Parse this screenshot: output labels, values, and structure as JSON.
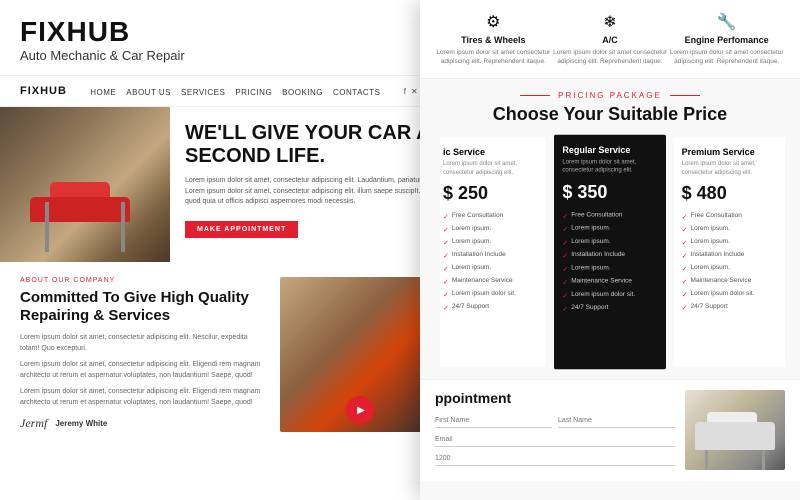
{
  "brand": {
    "title": "FIXHUB",
    "subtitle": "Auto Mechanic & Car Repair"
  },
  "nav": {
    "logo": "FIXHUB",
    "links": [
      "HOME",
      "ABOUT US",
      "SERVICES",
      "PRICING",
      "BOOKING",
      "CONTACTS"
    ]
  },
  "hero": {
    "headline": "WE'LL GIVE YOUR CAR A SECOND LIFE.",
    "text": "Lorem ipsum dolor sit amet, consectetur adipiscing elit. Laudantium, pariatur? Lorem ipsum dolor sit amet, consectetur adipiscing elit. illum saepe suscipIt. Minus quod quia ut officis adipisci aspernores modi necessiis.",
    "cta_label": "MAKE APPOINTMENT"
  },
  "about": {
    "tag": "ABOUT OUR COMPANY",
    "headline": "Committed To Give High Quality Repairing & Services",
    "para1": "Lorem ipsum dolor sit amet, consectetur adipiscing elit. Nescilur, expedita totam! Quo excepturi.",
    "para2": "Lorem ipsum dolor sit amet, consectetur adipiscing elit. Eligendi rem magnam architecto ut rerum et aspernatur voluptates, non laudantium! Saepe, quod!",
    "para3": "Lorem ipsum dolor sit amet, consectetur adipiscing elit. Eligendi rem magnam architecto ut rerum et aspernatur voluptates, non laudantium! Saepe, quod!",
    "signature": "Jeremy White",
    "signature_script": "Jermf"
  },
  "services": [
    {
      "name": "Tires & Wheels",
      "icon": "⚙",
      "desc": "Lorem ipsum dolor sit amet consectetur adipiscing elit. Reprehenderit itaque."
    },
    {
      "name": "A/C",
      "icon": "❄",
      "desc": "Lorem ipsum dolor sit amet consectetur adipiscing elit. Reprehenderit itaque."
    },
    {
      "name": "Engine Perfomance",
      "icon": "🔧",
      "desc": "Lorem ipsum dolor sit amet consectetur adipiscing elit. Reprehenderit itaque."
    }
  ],
  "pricing": {
    "tag": "PRICING PACKAGE",
    "headline": "Choose Your Suitable Price",
    "cards": [
      {
        "name": "ic Service",
        "desc": "Lorem ipsum dolor sit amet, consectetur adipiscing elit.",
        "price": "$ 250",
        "features": [
          "Free Consultation",
          "Lorem ipsum.",
          "Lorem ipsum.",
          "Installation Include",
          "Lorem ipsum.",
          "Maintenance Service",
          "Lorem ipsum dolor sit.",
          "24/7 Support"
        ],
        "featured": false
      },
      {
        "name": "Regular Service",
        "desc": "Lorem ipsum dolor sit amet, consectetur adipiscing elit.",
        "price": "$ 350",
        "features": [
          "Free Consultation",
          "Lorem ipsum.",
          "Lorem ipsum.",
          "Installation Include",
          "Lorem ipsum.",
          "Maintenance Service",
          "Lorem ipsum dolor sit.",
          "24/7 Support"
        ],
        "featured": true
      },
      {
        "name": "Premium Service",
        "desc": "Lorem ipsum dolor sit amet, consectetur adipiscing elit.",
        "price": "$ 480",
        "features": [
          "Free Consultation",
          "Lorem ipsum.",
          "Lorem ipsum.",
          "Installation Include",
          "Lorem ipsum.",
          "Maintenance Service",
          "Lorem ipsum dolor sit.",
          "24/7 Support"
        ],
        "featured": false
      }
    ]
  },
  "appointment": {
    "title": "ppointment",
    "fields": {
      "first_name_placeholder": "First Name",
      "last_name_placeholder": "Last Name",
      "email_placeholder": "Email",
      "phone_placeholder": "1200"
    }
  }
}
